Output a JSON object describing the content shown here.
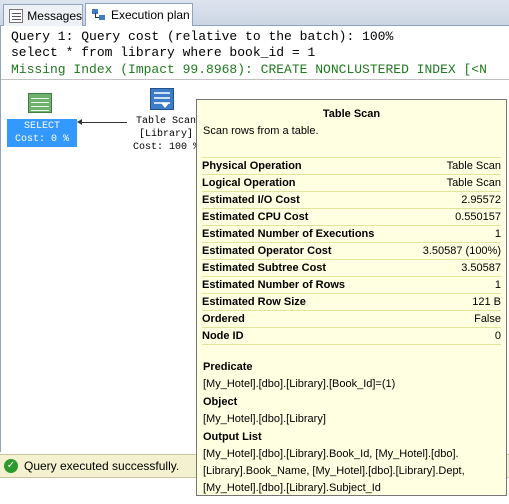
{
  "tabs": [
    {
      "label": "Messages",
      "icon": "messages-icon"
    },
    {
      "label": "Execution plan",
      "icon": "execution-plan-icon"
    }
  ],
  "query": {
    "line1": "Query 1: Query cost (relative to the batch): 100%",
    "line2": "select * from library where book_id = 1",
    "line3": "Missing Index (Impact 99.8968): CREATE NONCLUSTERED INDEX [<N"
  },
  "plan": {
    "select_node": {
      "label": "SELECT",
      "cost": "Cost: 0 %"
    },
    "scan_node": {
      "line1": "Table Scan",
      "line2": "[Library]",
      "line3": "Cost: 100 %"
    }
  },
  "tooltip": {
    "title": "Table Scan",
    "description": "Scan rows from a table.",
    "rows": [
      {
        "key": "Physical Operation",
        "value": "Table Scan"
      },
      {
        "key": "Logical Operation",
        "value": "Table Scan"
      },
      {
        "key": "Estimated I/O Cost",
        "value": "2.95572"
      },
      {
        "key": "Estimated CPU Cost",
        "value": "0.550157"
      },
      {
        "key": "Estimated Number of Executions",
        "value": "1"
      },
      {
        "key": "Estimated Operator Cost",
        "value": "3.50587 (100%)"
      },
      {
        "key": "Estimated Subtree Cost",
        "value": "3.50587"
      },
      {
        "key": "Estimated Number of Rows",
        "value": "1"
      },
      {
        "key": "Estimated Row Size",
        "value": "121 B"
      },
      {
        "key": "Ordered",
        "value": "False"
      },
      {
        "key": "Node ID",
        "value": "0"
      }
    ],
    "predicate_label": "Predicate",
    "predicate_value": "[My_Hotel].[dbo].[Library].[Book_Id]=(1)",
    "object_label": "Object",
    "object_value": "[My_Hotel].[dbo].[Library]",
    "output_label": "Output List",
    "output_lines": [
      "[My_Hotel].[dbo].[Library].Book_Id, [My_Hotel].[dbo].",
      "[Library].Book_Name, [My_Hotel].[dbo].[Library].Dept,",
      "[My_Hotel].[dbo].[Library].Subject_Id"
    ]
  },
  "status": {
    "text": "Query executed successfully."
  },
  "colors": {
    "accent_select": "#3399ff",
    "missing_index": "#1f7a1f",
    "tooltip_bg": "#ffffe1",
    "status_bg": "#f3f1cf"
  }
}
